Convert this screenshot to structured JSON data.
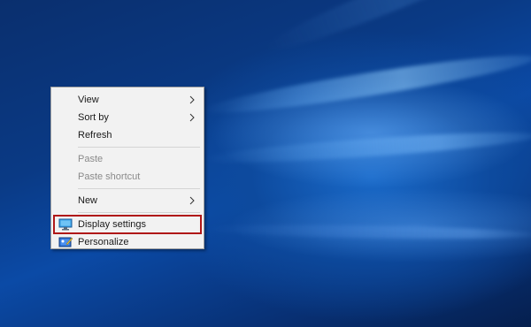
{
  "desktop": {
    "background_colors": {
      "dark": "#051f4e",
      "mid": "#0b4aa6",
      "light": "#6eb4ff"
    }
  },
  "context_menu": {
    "items": [
      {
        "label": "View",
        "submenu": true,
        "enabled": true
      },
      {
        "label": "Sort by",
        "submenu": true,
        "enabled": true
      },
      {
        "label": "Refresh",
        "submenu": false,
        "enabled": true
      },
      {
        "label": "Paste",
        "submenu": false,
        "enabled": false
      },
      {
        "label": "Paste shortcut",
        "submenu": false,
        "enabled": false
      },
      {
        "label": "New",
        "submenu": true,
        "enabled": true
      },
      {
        "label": "Display settings",
        "submenu": false,
        "enabled": true,
        "icon": "display-icon",
        "highlighted": true
      },
      {
        "label": "Personalize",
        "submenu": false,
        "enabled": true,
        "icon": "personalize-icon"
      }
    ],
    "highlight_color": "#b01818"
  }
}
